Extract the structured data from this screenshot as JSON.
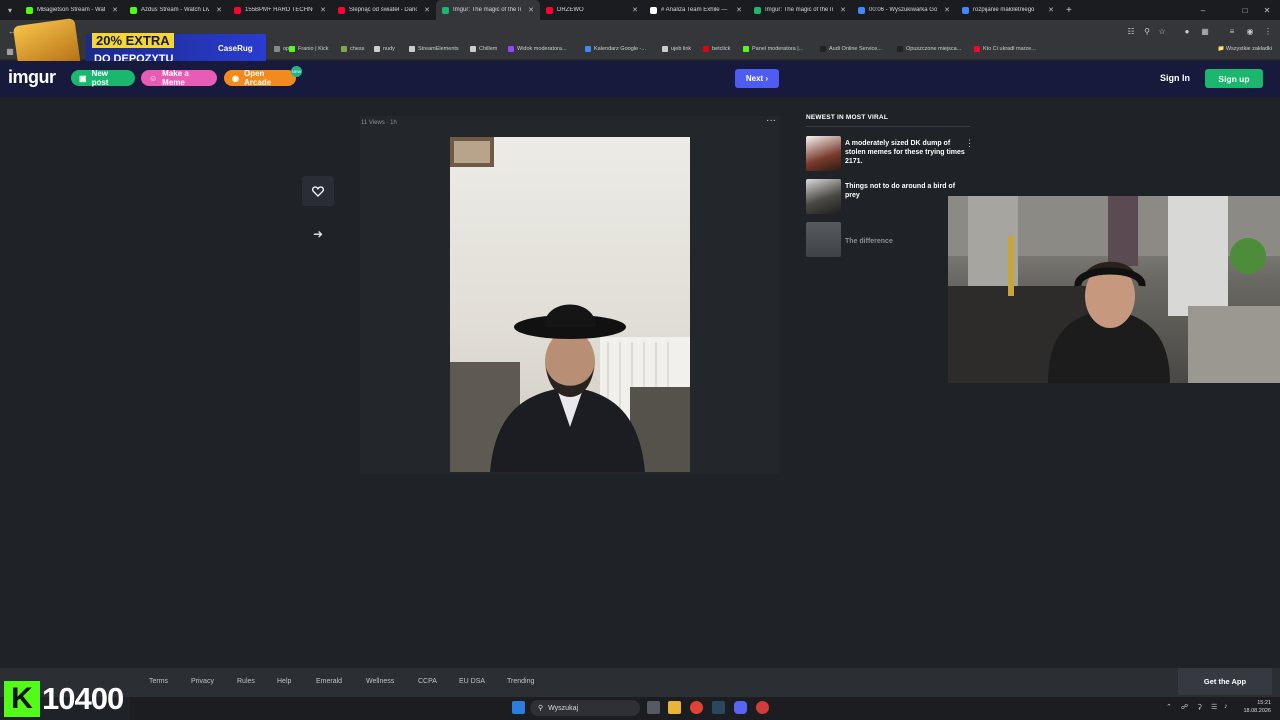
{
  "browser": {
    "tabs": [
      {
        "title": "MBagietson Stream - Watch",
        "color": "#53fc18",
        "active": false
      },
      {
        "title": "Azdus Stream - Watch Live",
        "color": "#53fc18",
        "active": false
      },
      {
        "title": "155BPM+ HARD TECHNO",
        "color": "#ff0033",
        "active": false
      },
      {
        "title": "Ślepnąc od świateł - Dario",
        "color": "#ff0033",
        "active": false
      },
      {
        "title": "Imgur: The magic of the Int",
        "color": "#1bb76e",
        "active": true
      },
      {
        "title": "DRZEWO",
        "color": "#ff0033",
        "active": false
      },
      {
        "title": "# Analiza Team Exhile —",
        "color": "#ffffff",
        "active": false
      },
      {
        "title": "Imgur: The magic of the Int",
        "color": "#1bb76e",
        "active": false
      },
      {
        "title": "00:06 - Wyszukiwarka Google",
        "color": "#4285f4",
        "active": false
      },
      {
        "title": "rozpijanie małoletniego",
        "color": "#4285f4",
        "active": false
      }
    ],
    "bookmarks": [
      {
        "label": "op",
        "color": "#888888"
      },
      {
        "label": "Franio | Kick",
        "color": "#53fc18"
      },
      {
        "label": "chess",
        "color": "#7fa650"
      },
      {
        "label": "nudy",
        "color": "#cccccc"
      },
      {
        "label": "StreamElements",
        "color": "#cccccc"
      },
      {
        "label": "Chillem",
        "color": "#cccccc"
      },
      {
        "label": "Widok moderatora...",
        "color": "#9146ff"
      },
      {
        "label": "Kalendarz Google -...",
        "color": "#4285f4"
      },
      {
        "label": "ujeb link",
        "color": "#cccccc"
      },
      {
        "label": "betclick",
        "color": "#e3000f"
      },
      {
        "label": "Panel moderatora |...",
        "color": "#53fc18"
      },
      {
        "label": "Audi Online Service...",
        "color": "#222222"
      },
      {
        "label": "Opuszczone miejsca...",
        "color": "#222222"
      },
      {
        "label": "Kto Ci ukradł marze...",
        "color": "#ff0033"
      }
    ],
    "bookmarks_other": "Wszystkie zakładki"
  },
  "ad": {
    "line1": "20% EXTRA",
    "line2": "DO DEPOZYTU",
    "brand": "CaseRug"
  },
  "header": {
    "logo": "imgur",
    "new_post": "New post",
    "make_meme": "Make a Meme",
    "open_arcade": "Open Arcade",
    "arcade_badge": "NEW",
    "next": "Next",
    "sign_in": "Sign In",
    "sign_up": "Sign up"
  },
  "post": {
    "views": "11 Views",
    "age": "1h",
    "more": "···"
  },
  "sidebar": {
    "title": "NEWEST IN MOST VIRAL",
    "items": [
      {
        "title": "A moderately sized DK dump of stolen memes for these trying times 2171.",
        "dim": false
      },
      {
        "title": "Things not to do around a bird of prey",
        "dim": false
      },
      {
        "title": "The difference",
        "dim": true
      }
    ]
  },
  "footer": {
    "links": [
      "Terms",
      "Privacy",
      "Rules",
      "Help",
      "Emerald",
      "Wellness",
      "CCPA",
      "EU DSA",
      "Trending"
    ],
    "get_app": "Get the App"
  },
  "overlay": {
    "kick_letter": "K",
    "kick_count": "10400"
  },
  "taskbar": {
    "search_placeholder": "Wyszukaj",
    "time": "15:21",
    "date": "18.08.2026"
  },
  "colors": {
    "imgur_header": "#171a3c",
    "next": "#4f5cf1",
    "sign_up": "#1bb76e",
    "new_post": "#1bb76e",
    "make_meme": "#e85cb6",
    "open_arcade": "#f28a1d",
    "kick": "#53fc18"
  }
}
